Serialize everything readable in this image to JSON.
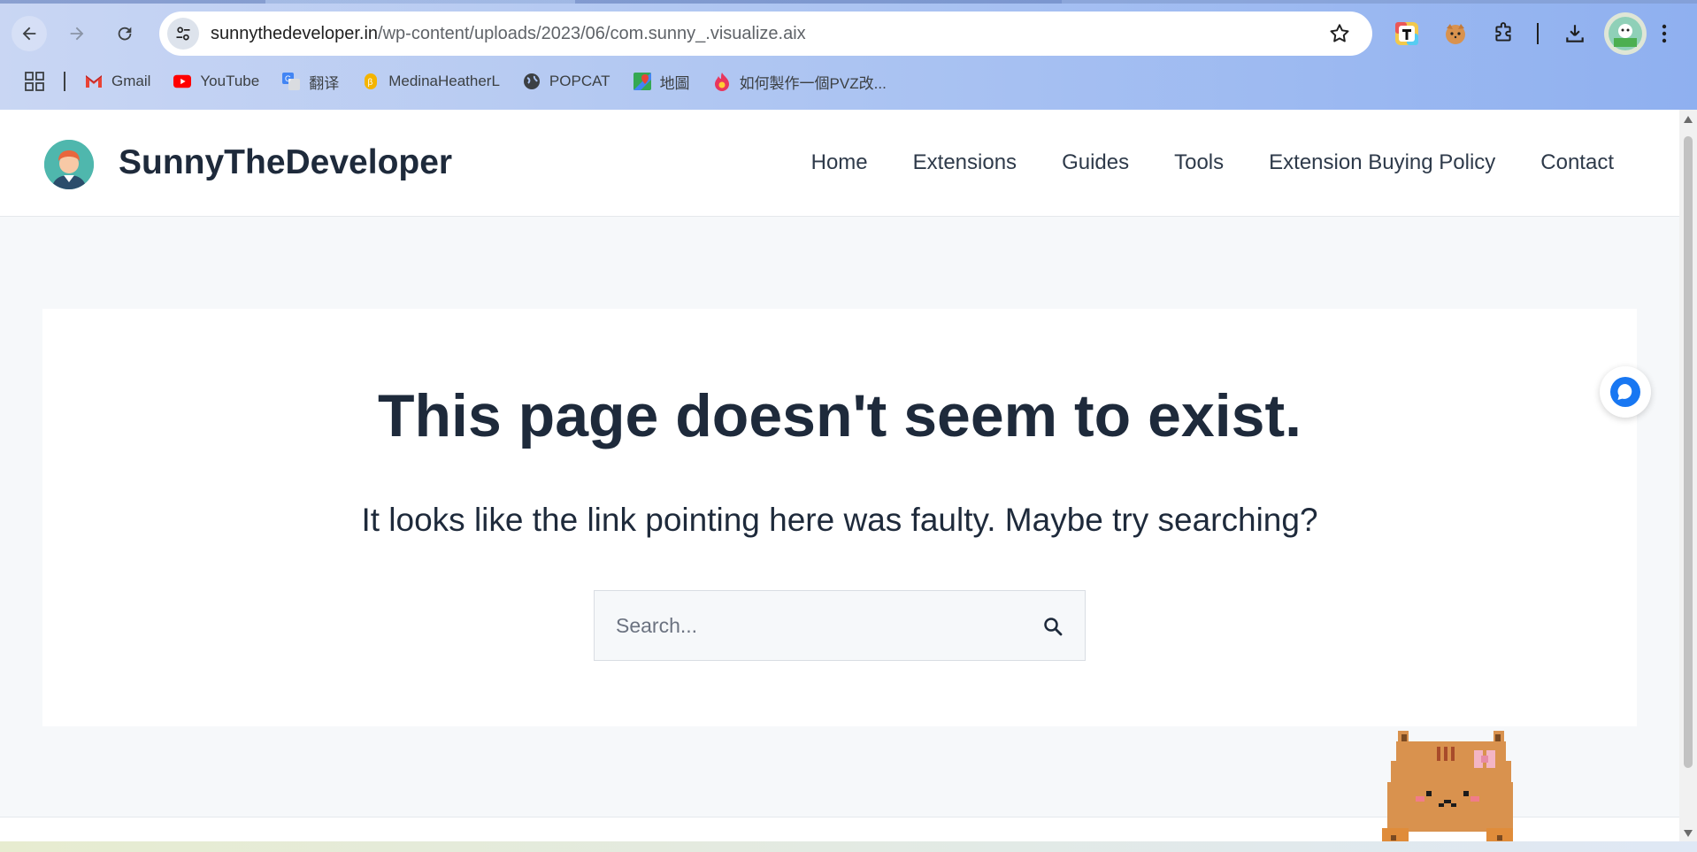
{
  "browser": {
    "url_host": "sunnythedeveloper.in",
    "url_path": "/wp-content/uploads/2023/06/com.sunny_.visualize.aix",
    "bookmarks": [
      {
        "label": "Gmail",
        "icon": "gmail-icon"
      },
      {
        "label": "YouTube",
        "icon": "youtube-icon"
      },
      {
        "label": "翻译",
        "icon": "translate-icon"
      },
      {
        "label": "MedinaHeatherL",
        "icon": "bookmark-site-icon"
      },
      {
        "label": "POPCAT",
        "icon": "globe-icon"
      },
      {
        "label": "地圖",
        "icon": "maps-icon"
      },
      {
        "label": "如何製作一個PVZ改...",
        "icon": "flame-icon"
      }
    ]
  },
  "site": {
    "title": "SunnyTheDeveloper",
    "nav": [
      "Home",
      "Extensions",
      "Guides",
      "Tools",
      "Extension Buying Policy",
      "Contact"
    ]
  },
  "error": {
    "headline": "This page doesn't seem to exist.",
    "subline": "It looks like the link pointing here was faulty. Maybe try searching?",
    "search_placeholder": "Search..."
  },
  "colors": {
    "heading": "#1e2a3b",
    "page_bg": "#f6f8fa",
    "chat_accent": "#1877f2"
  }
}
